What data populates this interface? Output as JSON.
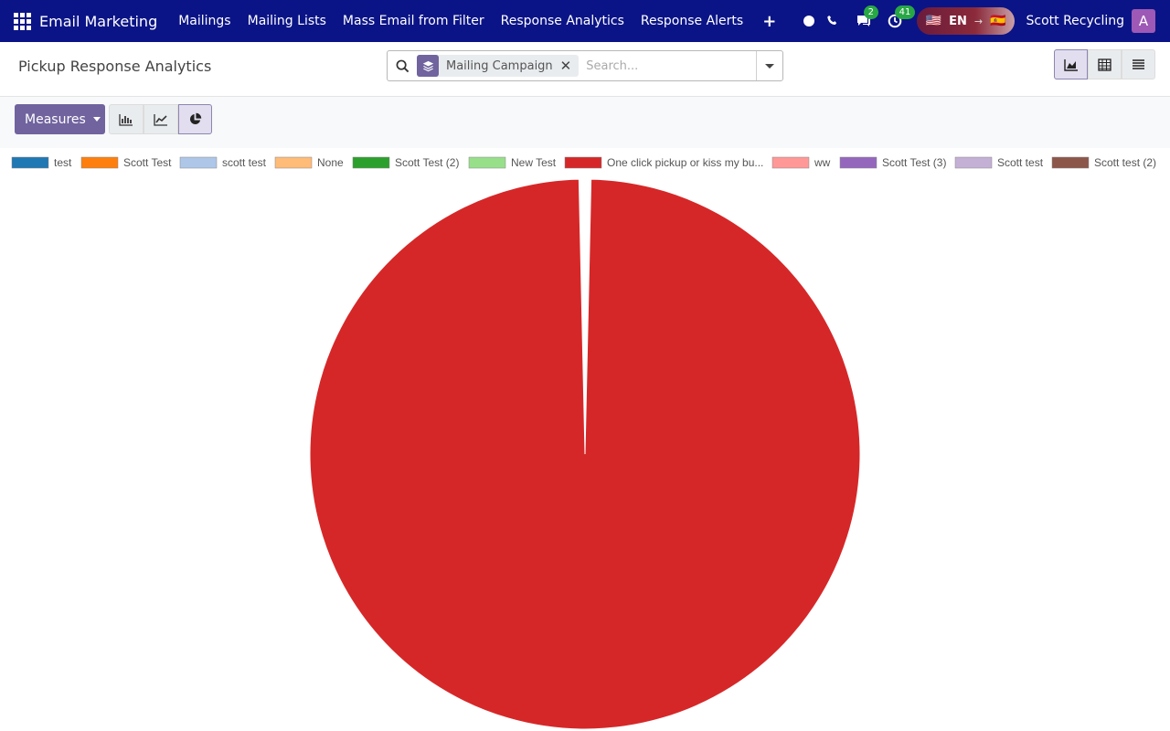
{
  "navbar": {
    "app_name": "Email Marketing",
    "menu": [
      "Mailings",
      "Mailing Lists",
      "Mass Email from Filter",
      "Response Analytics",
      "Response Alerts"
    ],
    "messages_badge": "2",
    "activities_badge": "41",
    "lang_code": "EN",
    "lang_from_flag": "🇺🇸",
    "lang_to_flag": "🇪🇸",
    "lang_arrow": "→",
    "plus_symbol": "+",
    "user_name": "Scott Recycling",
    "avatar_letter": "A",
    "bg_color": "#0b1486"
  },
  "control_panel": {
    "title": "Pickup Response Analytics",
    "search": {
      "facet_label": "Mailing Campaign",
      "placeholder": "Search..."
    },
    "views": [
      "graph-icon",
      "pivot-icon",
      "list-icon"
    ],
    "active_view": "graph-icon"
  },
  "toolbar": {
    "measures_label": "Measures",
    "modes": [
      "bar-chart-icon",
      "line-chart-icon",
      "pie-chart-icon"
    ],
    "active_mode": "pie-chart-icon",
    "accent_color": "#71639e"
  },
  "chart_data": {
    "type": "pie",
    "legend_position": "top",
    "series": [
      {
        "name": "test",
        "color": "#1f77b4",
        "value": 0
      },
      {
        "name": "Scott Test",
        "color": "#ff7f0e",
        "value": 0
      },
      {
        "name": "scott test",
        "color": "#aec7e8",
        "value": 0
      },
      {
        "name": "None",
        "color": "#ffbb78",
        "value": 0
      },
      {
        "name": "Scott Test (2)",
        "color": "#2ca02c",
        "value": 0
      },
      {
        "name": "New Test",
        "color": "#98df8a",
        "value": 0
      },
      {
        "name": "One click pickup or kiss my bu...",
        "color": "#d62728",
        "value": 99.3
      },
      {
        "name": "ww",
        "color": "#ff9896",
        "value": 0
      },
      {
        "name": "Scott Test (3)",
        "color": "#9467bd",
        "value": 0
      },
      {
        "name": "Scott test",
        "color": "#c5b0d5",
        "value": 0
      },
      {
        "name": "Scott test (2)",
        "color": "#8c564b",
        "value": 0
      }
    ],
    "gap_value": 0.7
  }
}
